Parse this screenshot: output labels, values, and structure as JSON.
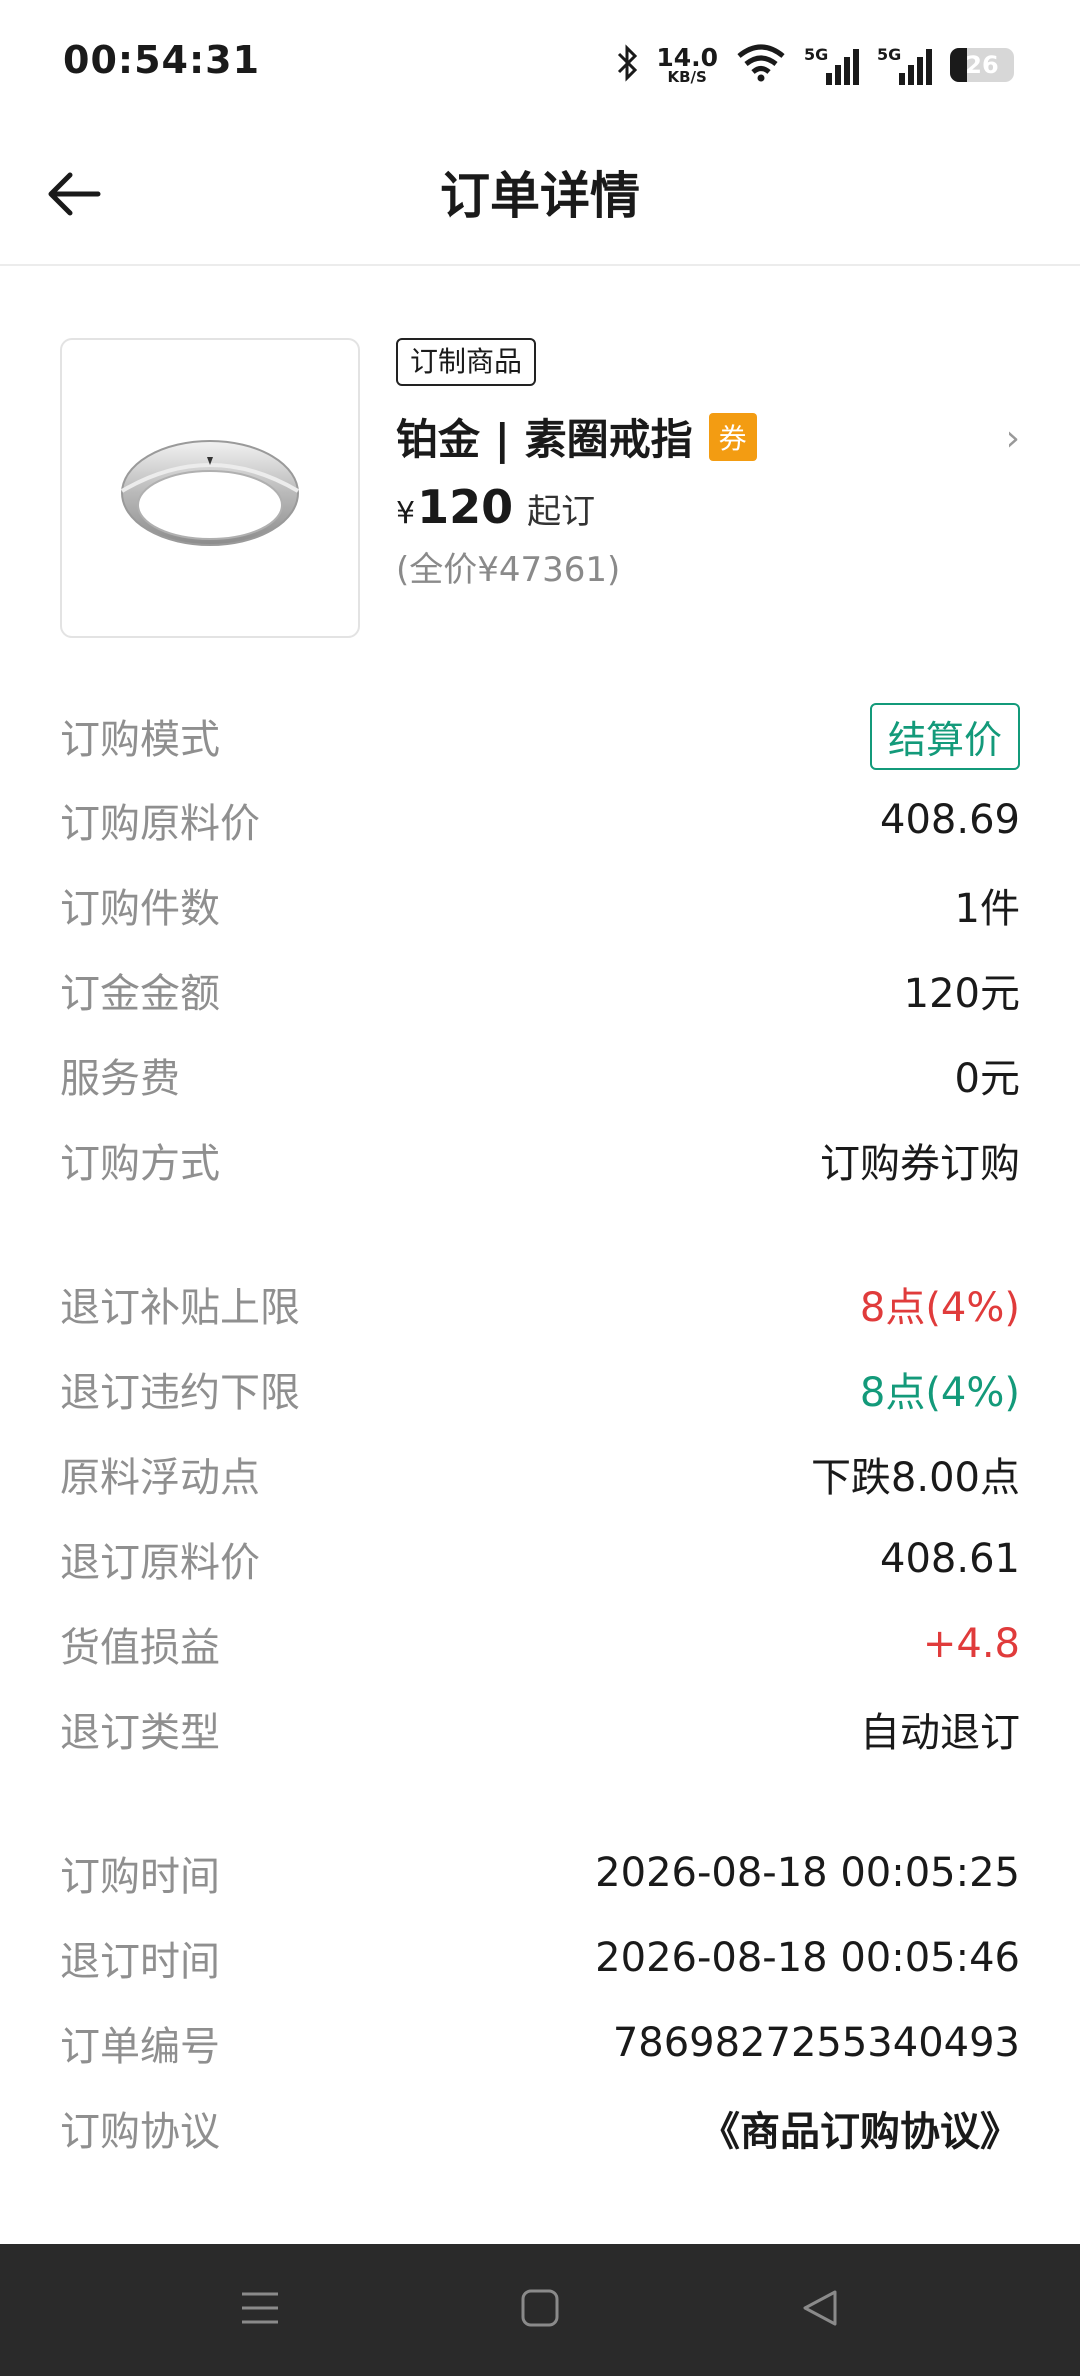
{
  "status": {
    "time": "00:54:31",
    "net_speed": "14.0",
    "net_unit": "KB/S",
    "sim1": "5G",
    "sim2": "5G",
    "battery": "26"
  },
  "header": {
    "title": "订单详情"
  },
  "product": {
    "tag": "订制商品",
    "name": "铂金 | 素圈戒指",
    "coupon_badge": "券",
    "price_currency": "¥",
    "price_value": "120",
    "price_suffix": "起订",
    "full_price": "(全价¥47361)"
  },
  "details": [
    {
      "label": "订购模式",
      "value": "结算价"
    },
    {
      "label": "订购原料价",
      "value": "408.69"
    },
    {
      "label": "订购件数",
      "value": "1件"
    },
    {
      "label": "订金金额",
      "value": "120元"
    },
    {
      "label": "服务费",
      "value": "0元"
    },
    {
      "label": "订购方式",
      "value": "订购券订购"
    },
    {
      "label": "退订补贴上限",
      "value": "8点(4%)"
    },
    {
      "label": "退订违约下限",
      "value": "8点(4%)"
    },
    {
      "label": "原料浮动点",
      "value": "下跌8.00点"
    },
    {
      "label": "退订原料价",
      "value": "408.61"
    },
    {
      "label": "货值损益",
      "value": "+4.8"
    },
    {
      "label": "退订类型",
      "value": "自动退订"
    },
    {
      "label": "订购时间",
      "value": "2026-08-18 00:05:25"
    },
    {
      "label": "退订时间",
      "value": "2026-08-18 00:05:46"
    },
    {
      "label": "订单编号",
      "value": "7869827255340493"
    },
    {
      "label": "订购协议",
      "value": "《商品订购协议》"
    }
  ],
  "colors": {
    "accent_green": "#139a7a",
    "accent_red": "#e03b3b",
    "coupon_orange": "#f39c12"
  }
}
